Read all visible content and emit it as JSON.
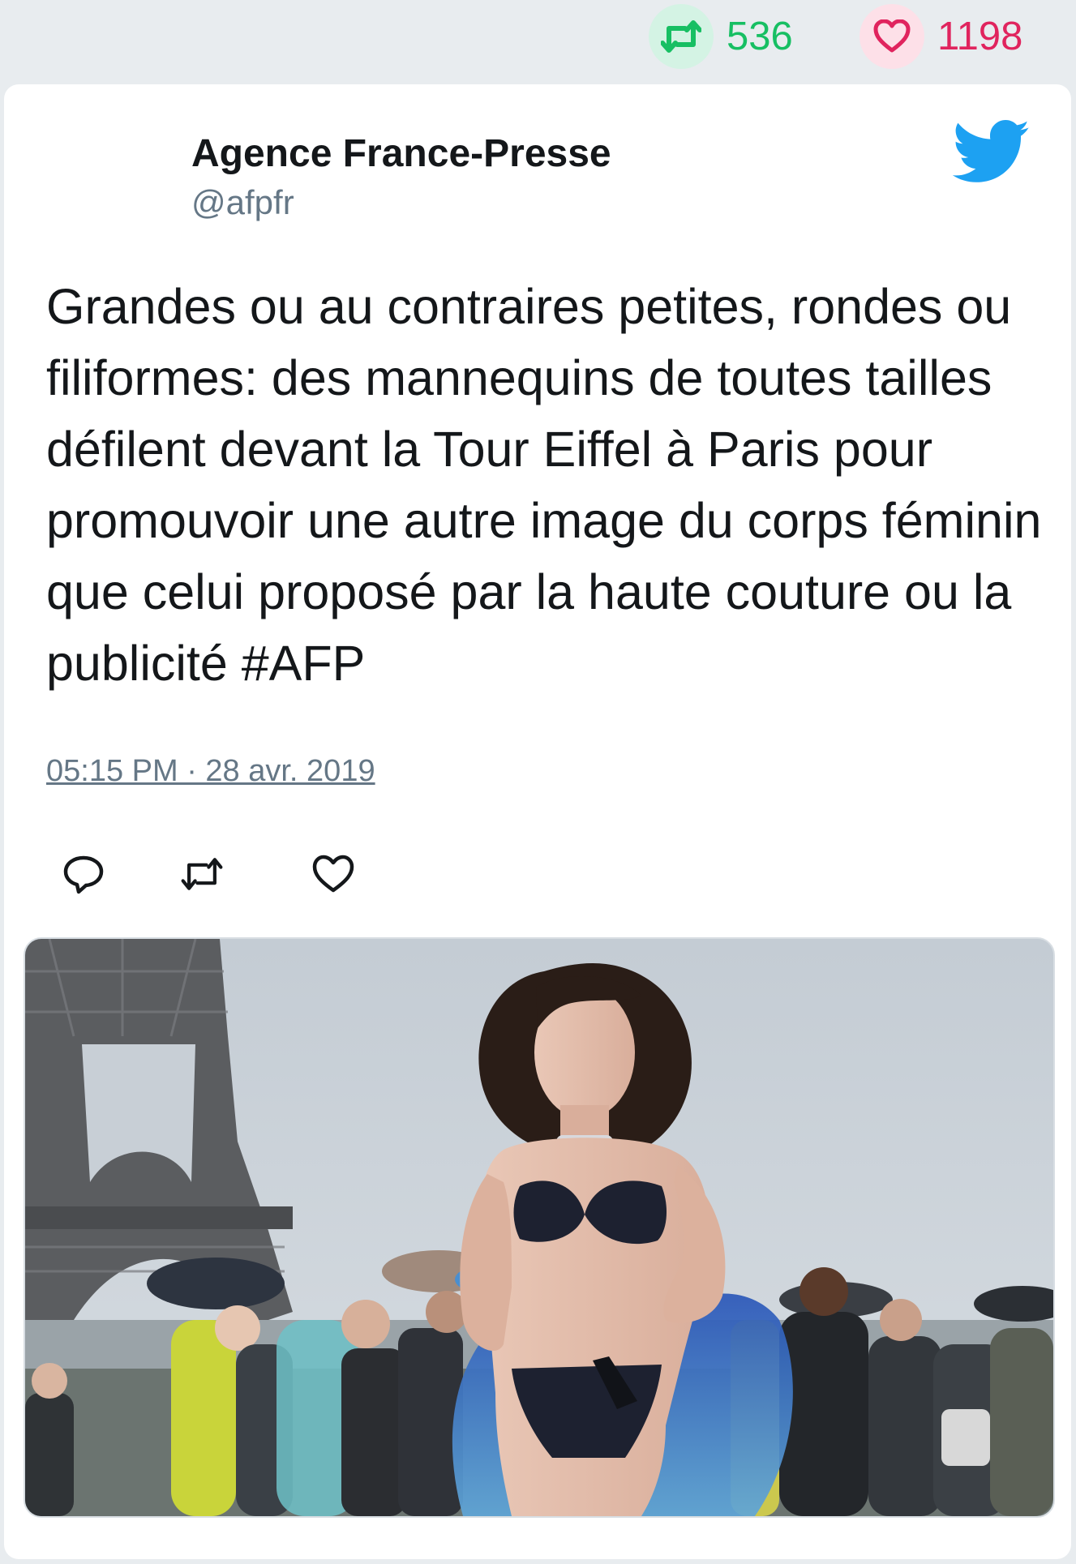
{
  "stats": {
    "retweets": "536",
    "likes": "1198",
    "retweet_icon": "retweet-icon",
    "like_icon": "heart-icon"
  },
  "tweet": {
    "author_name": "Agence France-Presse",
    "author_handle": "@afpfr",
    "text": "Grandes ou au contraires petites, rondes ou filiformes: des mannequins de toutes tailles défilent devant la Tour Eiffel à Paris pour promouvoir une autre image du corps féminin que celui proposé par la haute couture ou la publicité #AFP",
    "timestamp": "05:15 PM · 28 avr. 2019",
    "platform_icon": "twitter-bird-icon"
  },
  "actions": [
    "reply-icon",
    "retweet-icon",
    "heart-icon"
  ],
  "colors": {
    "retweet": "#17bf63",
    "like": "#e0245e",
    "twitter_blue": "#1da1f2",
    "text": "#14171a",
    "muted": "#657786"
  },
  "media": {
    "type": "photo"
  }
}
